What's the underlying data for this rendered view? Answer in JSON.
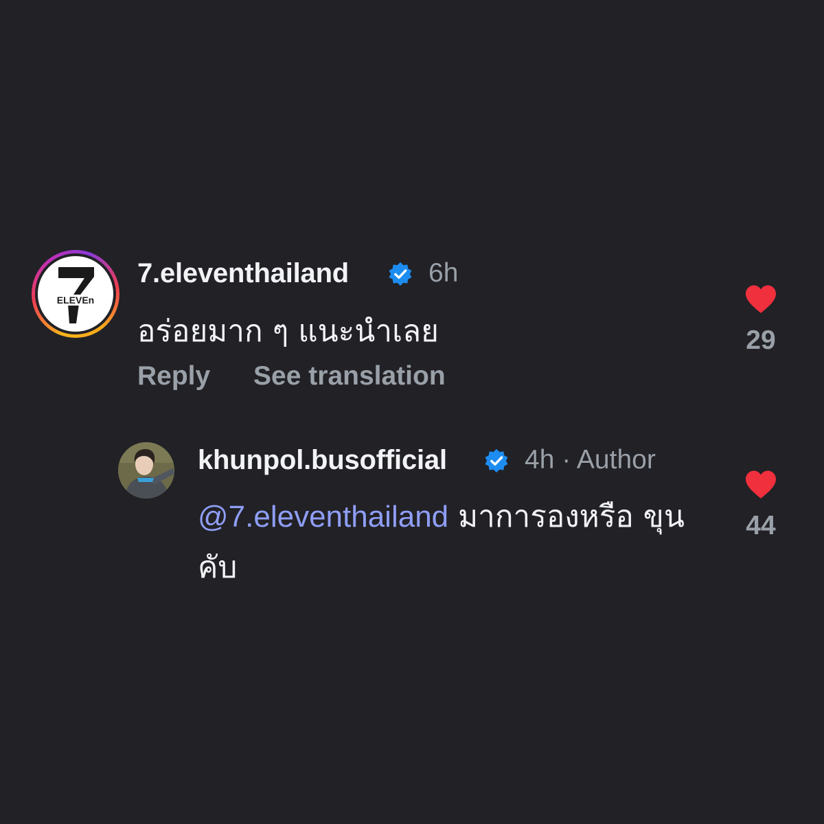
{
  "comments": [
    {
      "username": "7.eleventhailand",
      "time": "6h",
      "text": "อร่อยมาก ๆ แนะนำเลย",
      "reply_label": "Reply",
      "translate_label": "See translation",
      "likes": "29",
      "avatar_icon": "seven-eleven-logo",
      "verified_icon": "verified-badge-icon"
    },
    {
      "username": "khunpol.busofficial",
      "time": "4h",
      "separator": "·",
      "author_label": "Author",
      "mention": "@7.eleventhailand",
      "text": "มาการองหรือ ขุนคับ",
      "likes": "44",
      "avatar_icon": "user-avatar",
      "verified_icon": "verified-badge-icon"
    }
  ],
  "logo_text": "ELEVEn",
  "colors": {
    "background": "#212126",
    "text_primary": "#f2f3f5",
    "text_secondary": "#9aa0a8",
    "mention": "#8f9ef5",
    "verified": "#1d8cf0",
    "heart": "#f0303d"
  }
}
